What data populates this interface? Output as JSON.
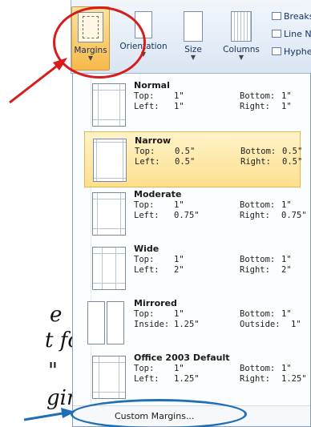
{
  "ribbon": {
    "buttons": [
      {
        "label": "Margins"
      },
      {
        "label": "Orientation"
      },
      {
        "label": "Size"
      },
      {
        "label": "Columns"
      }
    ],
    "right_items": [
      "Breaks",
      "Line N",
      "Hyphe"
    ]
  },
  "margins_menu": {
    "options": [
      {
        "name": "Normal",
        "row1": [
          "Top:",
          "1\"",
          "Bottom:",
          "1\""
        ],
        "row2": [
          "Left:",
          "1\"",
          "Right:",
          "1\""
        ],
        "selected": false
      },
      {
        "name": "Narrow",
        "row1": [
          "Top:",
          "0.5\"",
          "Bottom:",
          "0.5\""
        ],
        "row2": [
          "Left:",
          "0.5\"",
          "Right:",
          "0.5\""
        ],
        "selected": true
      },
      {
        "name": "Moderate",
        "row1": [
          "Top:",
          "1\"",
          "Bottom:",
          "1\""
        ],
        "row2": [
          "Left:",
          "0.75\"",
          "Right:",
          "0.75\""
        ],
        "selected": false
      },
      {
        "name": "Wide",
        "row1": [
          "Top:",
          "1\"",
          "Bottom:",
          "1\""
        ],
        "row2": [
          "Left:",
          "2\"",
          "Right:",
          "2\""
        ],
        "selected": false
      },
      {
        "name": "Mirrored",
        "row1": [
          "Top:",
          "1\"",
          "Bottom:",
          "1\""
        ],
        "row2": [
          "Inside:",
          "1.25\"",
          "Outside:",
          "1\""
        ],
        "selected": false
      },
      {
        "name": "Office 2003 Default",
        "row1": [
          "Top:",
          "1\"",
          "Bottom:",
          "1\""
        ],
        "row2": [
          "Left:",
          "1.25\"",
          "Right:",
          "1.25\""
        ],
        "selected": false
      }
    ],
    "custom_label": "Custom Margins..."
  },
  "annotation": {
    "line1": "e",
    "line2": "t for",
    "line3": "\"",
    "line4": "gins"
  },
  "colors": {
    "highlight_circle": "#d81b1b",
    "highlight_ellipse": "#1f6fb8",
    "selected_option": "#fde08f"
  }
}
